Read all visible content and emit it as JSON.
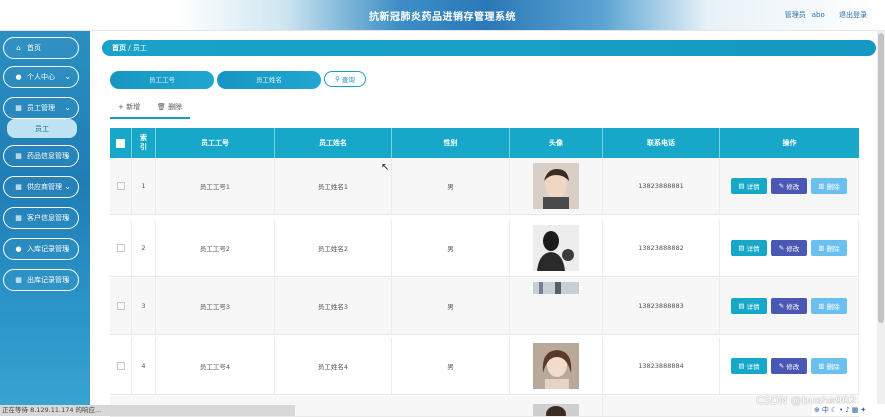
{
  "header": {
    "title": "抗新冠肺炎药品进销存管理系统",
    "role_label": "管理员",
    "username": "abo",
    "logout_label": "退出登录"
  },
  "sidebar": {
    "items": [
      {
        "label": "首页",
        "icon": "home-icon",
        "has_chevron": false
      },
      {
        "label": "个人中心",
        "icon": "user-icon",
        "has_chevron": true
      },
      {
        "label": "员工管理",
        "icon": "grid-icon",
        "has_chevron": true
      },
      {
        "label": "药品信息管理",
        "icon": "grid-icon",
        "has_chevron": true
      },
      {
        "label": "供应商管理",
        "icon": "grid-icon",
        "has_chevron": true
      },
      {
        "label": "客户信息管理",
        "icon": "grid-icon",
        "has_chevron": true
      },
      {
        "label": "入库记录管理",
        "icon": "user-icon",
        "has_chevron": true
      },
      {
        "label": "出库记录管理",
        "icon": "grid-icon",
        "has_chevron": true
      }
    ],
    "active_sub": "员工"
  },
  "breadcrumb": {
    "home": "首页",
    "separator": "/",
    "current": "员工"
  },
  "search": {
    "field1_placeholder": "员工工号",
    "field2_placeholder": "员工姓名",
    "button_label": "查询"
  },
  "actions": {
    "add_label": "新增",
    "delete_label": "删除"
  },
  "table": {
    "headers": [
      "",
      "索引",
      "员工工号",
      "员工姓名",
      "性别",
      "头像",
      "联系电话",
      "操作"
    ],
    "rows": [
      {
        "index": "1",
        "emp_id": "员工工号1",
        "name": "员工姓名1",
        "gender": "男",
        "phone": "13823888881",
        "avatar": "man-portrait"
      },
      {
        "index": "2",
        "emp_id": "员工工号2",
        "name": "员工姓名2",
        "gender": "男",
        "phone": "13823888882",
        "avatar": "silhouette-portrait"
      },
      {
        "index": "3",
        "emp_id": "员工工号3",
        "name": "员工姓名3",
        "gender": "男",
        "phone": "13823888883",
        "avatar": "partial-portrait"
      },
      {
        "index": "4",
        "emp_id": "员工工号4",
        "name": "员工姓名4",
        "gender": "男",
        "phone": "13823888884",
        "avatar": "woman-portrait"
      }
    ],
    "btn_detail": "详情",
    "btn_edit": "修改",
    "btn_delete": "删除"
  },
  "status_bar": "正在等待 8.129.11.174 的响应...",
  "watermark": "CSDN @bushe902",
  "colors": {
    "accent": "#17a8c9",
    "edit": "#4a57b3",
    "delete": "#6cc0f0"
  }
}
